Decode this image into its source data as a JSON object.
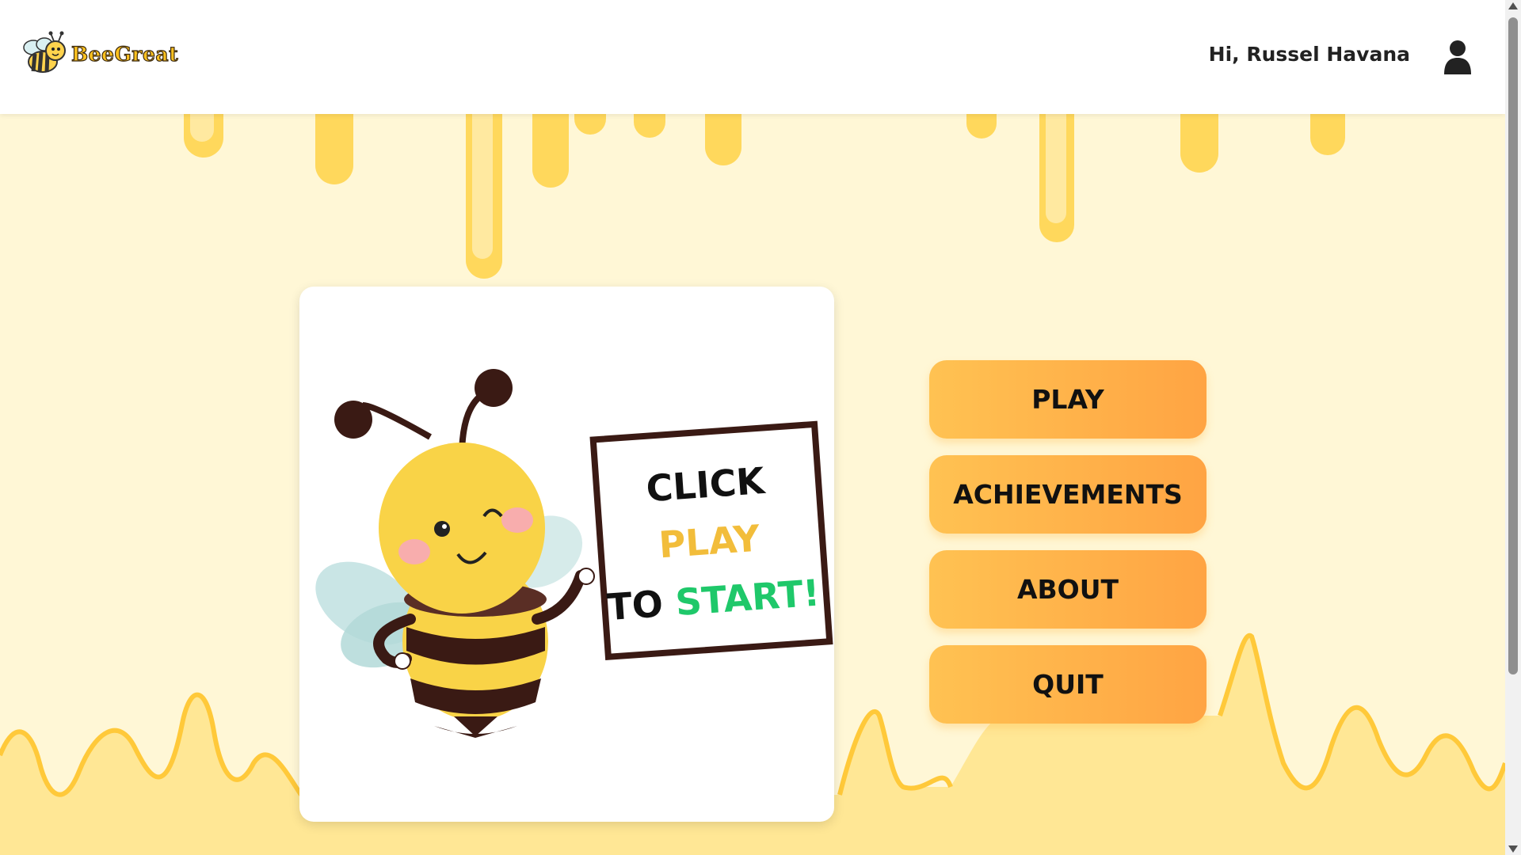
{
  "header": {
    "brand": "BeeGreat",
    "logo_icon": "bee-icon",
    "greeting": "Hi, Russel Havana",
    "user_icon": "user-icon"
  },
  "card": {
    "sign_line1": "CLICK",
    "sign_line2": "PLAY",
    "sign_line3a": "TO",
    "sign_line3b": "START!"
  },
  "menu": {
    "play": "PLAY",
    "achievements": "ACHIEVEMENTS",
    "about": "ABOUT",
    "quit": "QUIT"
  },
  "colors": {
    "honey": "#ffd34d",
    "background": "#fff7d6",
    "button_start": "#ffc252",
    "button_end": "#ffa443",
    "sign_play": "#f2bd3b",
    "sign_start": "#1fc86a"
  }
}
